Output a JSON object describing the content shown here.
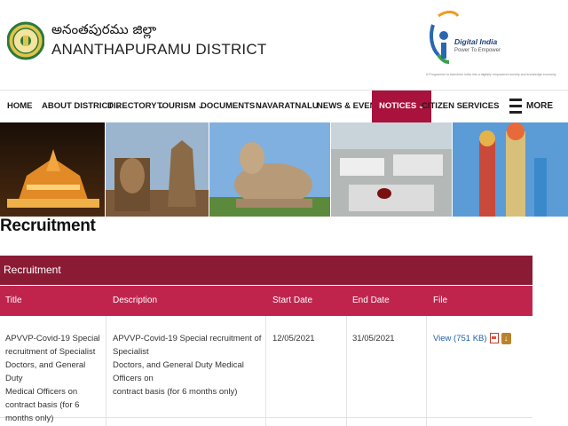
{
  "header": {
    "title_telugu": "అనంతపురము జిల్లా",
    "title_english": "ANANTHAPURAMU DISTRICT",
    "digital_india": {
      "title": "Digital India",
      "tagline": "Power To Empower",
      "footnote": "A Programme to transform India into a digitally empowered society and knowledge economy"
    },
    "emblem_icon": "ap-state-emblem-icon"
  },
  "nav": {
    "items": [
      {
        "label": "HOME",
        "dropdown": false
      },
      {
        "label": "ABOUT DISTRICT",
        "dropdown": true
      },
      {
        "label": "DIRECTORY",
        "dropdown": true
      },
      {
        "label": "TOURISM",
        "dropdown": true
      },
      {
        "label": "DOCUMENTS",
        "dropdown": true
      },
      {
        "label": "NAVARATNALU",
        "dropdown": false
      },
      {
        "label": "NEWS & EVENTS",
        "dropdown": true
      },
      {
        "label": "NOTICES",
        "dropdown": true,
        "active": true
      },
      {
        "label": "CITIZEN SERVICES",
        "dropdown": false
      }
    ],
    "more_label": "MORE",
    "active_color": "#a8123d"
  },
  "page": {
    "title": "Recruitment"
  },
  "table": {
    "section_label": "Recruitment",
    "section_color": "#8b1a35",
    "header_color": "#c0244d",
    "columns": [
      "Title",
      "Description",
      "Start Date",
      "End Date",
      "File"
    ],
    "rows": [
      {
        "title_lines": [
          "APVVP-Covid-19 Special",
          "recruitment of Specialist",
          "Doctors, and General Duty",
          "Medical Officers on",
          "contract basis (for 6",
          "months only)"
        ],
        "description_lines": [
          "APVVP-Covid-19 Special recruitment of Specialist",
          "Doctors, and General Duty Medical Officers on",
          "contract basis (for 6 months only)"
        ],
        "start_date": "12/05/2021",
        "end_date": "31/05/2021",
        "file_link": "View (751 KB)"
      }
    ]
  }
}
